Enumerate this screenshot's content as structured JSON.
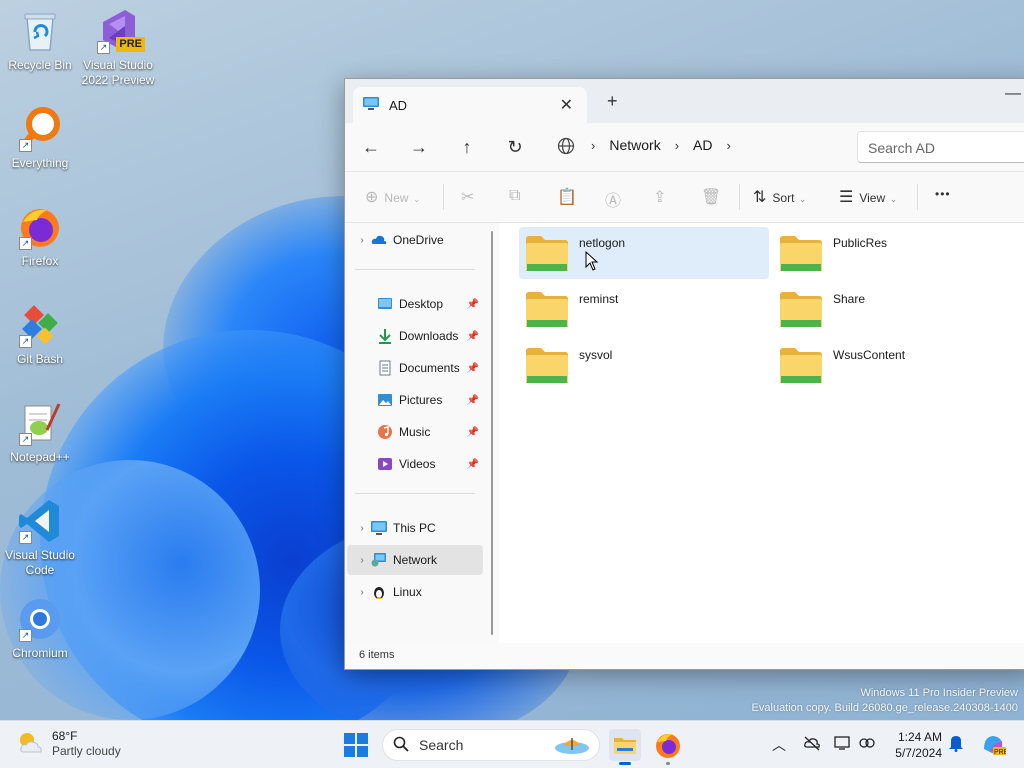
{
  "desktop": {
    "icons": [
      {
        "label": "Recycle Bin",
        "icon": "recycle-bin-icon"
      },
      {
        "label": "Visual Studio 2022 Preview",
        "icon": "visual-studio-icon",
        "badge": "PRE"
      },
      {
        "label": "Everything",
        "icon": "everything-search-icon"
      },
      {
        "label": "Firefox",
        "icon": "firefox-icon"
      },
      {
        "label": "Git Bash",
        "icon": "git-bash-icon"
      },
      {
        "label": "Notepad++",
        "icon": "notepadpp-icon"
      },
      {
        "label": "Visual Studio Code",
        "icon": "vscode-icon"
      },
      {
        "label": "Chromium",
        "icon": "chromium-icon"
      }
    ]
  },
  "window": {
    "tab_title": "AD",
    "close_glyph": "✕",
    "new_tab_glyph": "+",
    "minimize_glyph": "—",
    "nav": {
      "back": "←",
      "forward": "→",
      "up": "↑",
      "refresh": "↻"
    },
    "breadcrumb": [
      "Network",
      "AD"
    ],
    "crumb_sep": "›",
    "search_placeholder": "Search AD",
    "toolbar": {
      "new_label": "New",
      "sort_label": "Sort",
      "view_label": "View",
      "more_glyph": "•••"
    },
    "sidebar": {
      "onedrive": "OneDrive",
      "quick_access": [
        {
          "label": "Desktop"
        },
        {
          "label": "Downloads"
        },
        {
          "label": "Documents"
        },
        {
          "label": "Pictures"
        },
        {
          "label": "Music"
        },
        {
          "label": "Videos"
        }
      ],
      "this_pc": "This PC",
      "network": "Network",
      "linux": "Linux"
    },
    "folders": [
      {
        "name": "netlogon",
        "selected": true
      },
      {
        "name": "PublicRes",
        "selected": false
      },
      {
        "name": "reminst",
        "selected": false
      },
      {
        "name": "Share",
        "selected": false
      },
      {
        "name": "sysvol",
        "selected": false
      },
      {
        "name": "WsusContent",
        "selected": false
      }
    ],
    "status": "6 items"
  },
  "watermark": {
    "line1": "Windows 11 Pro Insider Preview",
    "line2": "Evaluation copy. Build 26080.ge_release.240308-1400"
  },
  "taskbar": {
    "weather_temp": "68°F",
    "weather_desc": "Partly cloudy",
    "search_label": "Search",
    "time": "1:24 AM",
    "date": "5/7/2024"
  },
  "colors": {
    "accent": "#0067c0",
    "folder_yellow": "#f8c94a",
    "selection": "#dfedfb"
  }
}
